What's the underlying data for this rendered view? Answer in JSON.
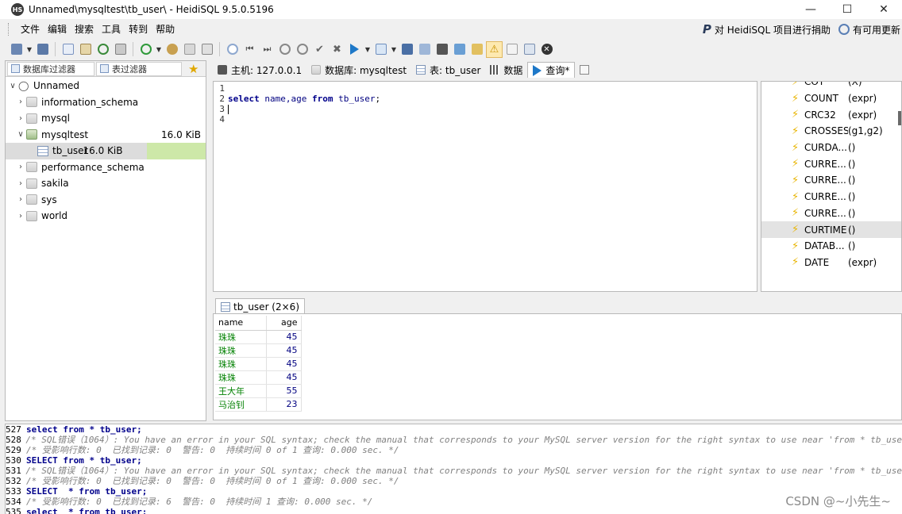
{
  "window": {
    "title": "Unnamed\\mysqltest\\tb_user\\ - HeidiSQL 9.5.0.5196",
    "app_icon_text": "HS"
  },
  "menu": {
    "items": [
      "文件",
      "编辑",
      "搜索",
      "工具",
      "转到",
      "帮助"
    ],
    "right_links": [
      "对 HeidiSQL 项目进行捐助",
      "有可用更新"
    ]
  },
  "filters": {
    "db_filter_placeholder": "数据库过滤器",
    "table_filter_placeholder": "表过滤器"
  },
  "tree": {
    "root": "Unnamed",
    "databases": [
      {
        "name": "information_schema",
        "size": ""
      },
      {
        "name": "mysql",
        "size": ""
      },
      {
        "name": "mysqltest",
        "size": "16.0 KiB"
      },
      {
        "name": "performance_schema",
        "size": ""
      },
      {
        "name": "sakila",
        "size": ""
      },
      {
        "name": "sys",
        "size": ""
      },
      {
        "name": "world",
        "size": ""
      }
    ],
    "selected_table": {
      "name": "tb_user",
      "size": "16.0 KiB"
    }
  },
  "tabs": [
    {
      "label": "主机: 127.0.0.1",
      "icon": "host-icon"
    },
    {
      "label": "数据库: mysqltest",
      "icon": "database-icon"
    },
    {
      "label": "表: tb_user",
      "icon": "table-icon"
    },
    {
      "label": "数据",
      "icon": "data-grid-icon"
    },
    {
      "label": "查询*",
      "icon": "play-icon"
    }
  ],
  "editor": {
    "line_numbers": [
      "1",
      "2",
      "3",
      "4"
    ],
    "query": {
      "kw_select": "select",
      "cols": "name,age",
      "kw_from": "from",
      "table": "tb_user",
      "end": ";"
    }
  },
  "functions": [
    {
      "name": "COT",
      "args": "(X)"
    },
    {
      "name": "COUNT",
      "args": "(expr)"
    },
    {
      "name": "CRC32",
      "args": "(expr)"
    },
    {
      "name": "CROSSES",
      "args": "(g1,g2)"
    },
    {
      "name": "CURDA...",
      "args": "()"
    },
    {
      "name": "CURRE...",
      "args": "()"
    },
    {
      "name": "CURRE...",
      "args": "()"
    },
    {
      "name": "CURRE...",
      "args": "()"
    },
    {
      "name": "CURRE...",
      "args": "()"
    },
    {
      "name": "CURTIME",
      "args": "()"
    },
    {
      "name": "DATAB...",
      "args": "()"
    },
    {
      "name": "DATE",
      "args": "(expr)"
    }
  ],
  "functions_selected_index": 9,
  "result": {
    "tab_label": "tb_user (2×6)",
    "columns": [
      "name",
      "age"
    ],
    "rows": [
      [
        "珠珠",
        "45"
      ],
      [
        "珠珠",
        "45"
      ],
      [
        "珠珠",
        "45"
      ],
      [
        "珠珠",
        "45"
      ],
      [
        "王大年",
        "55"
      ],
      [
        "马治钊",
        "23"
      ]
    ]
  },
  "log": [
    {
      "num": "527",
      "type": "sql",
      "text": "select from * tb_user;"
    },
    {
      "num": "528",
      "type": "cmt",
      "text": "/* SQL错误（1064）: You have an error in your SQL syntax; check the manual that corresponds to your MySQL server version for the right syntax to use near 'from * tb_use"
    },
    {
      "num": "529",
      "type": "cmt",
      "text": "/* 受影响行数: 0  已找到记录: 0  警告: 0  持续时间 0 of 1 查询: 0.000 sec. */"
    },
    {
      "num": "530",
      "type": "sql",
      "text": "SELECT from * tb_user;"
    },
    {
      "num": "531",
      "type": "cmt",
      "text": "/* SQL错误（1064）: You have an error in your SQL syntax; check the manual that corresponds to your MySQL server version for the right syntax to use near 'from * tb_use"
    },
    {
      "num": "532",
      "type": "cmt",
      "text": "/* 受影响行数: 0  已找到记录: 0  警告: 0  持续时间 0 of 1 查询: 0.000 sec. */"
    },
    {
      "num": "533",
      "type": "sql",
      "text": "SELECT  * from tb_user;"
    },
    {
      "num": "534",
      "type": "cmt",
      "text": "/* 受影响行数: 0  已找到记录: 6  警告: 0  持续时间 1 查询: 0.000 sec. */"
    },
    {
      "num": "535",
      "type": "sql",
      "text": "select  * from tb_user;"
    }
  ],
  "watermark": "CSDN @~小先生~"
}
